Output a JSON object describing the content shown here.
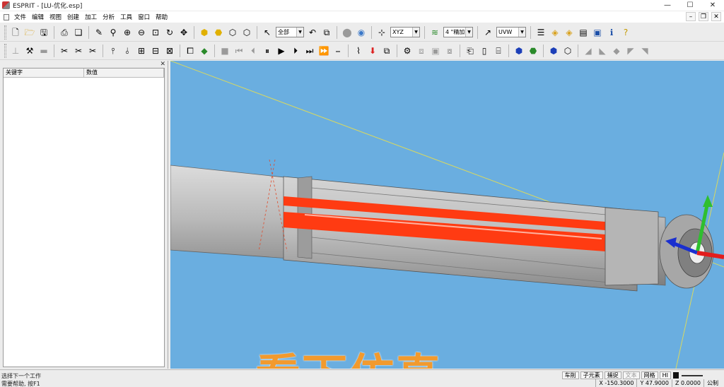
{
  "title": "ESPRIT - [LU-优化.esp]",
  "window_controls": [
    "—",
    "☐",
    "✕"
  ],
  "mdi_controls": [
    "–",
    "❐",
    "✕"
  ],
  "menu": [
    "文件",
    "编辑",
    "视图",
    "创建",
    "加工",
    "分析",
    "工具",
    "窗口",
    "帮助"
  ],
  "toolbar1": {
    "select_filter": "全部",
    "plane_combo": "XYZ",
    "layer_combo": "4 \"精加\"",
    "work_coord_combo": "UVW"
  },
  "toolbar1_icons": [
    "new-file",
    "open-folder",
    "save",
    "print",
    "print-preview",
    "sep",
    "paint-brush",
    "zoom",
    "zoom-in",
    "zoom-out",
    "zoom-window",
    "rotate",
    "pan",
    "sep",
    "solid-shade",
    "solid-shade-2",
    "wireframe",
    "hidden-lines",
    "sep",
    "select-arrow",
    "combo:select_filter",
    "undo",
    "redo-view",
    "sep",
    "stop",
    "help-circle",
    "sep",
    "axes",
    "combo:plane_combo",
    "sep",
    "layers",
    "combo:layer_combo",
    "sep",
    "work-coord",
    "combo:work_coord_combo",
    "sep",
    "list",
    "stack",
    "stack-2",
    "gallery",
    "image",
    "info",
    "help-question"
  ],
  "toolbar2_icons": [
    "tool-1",
    "tool-2",
    "tool-3",
    "sep",
    "tool-4",
    "tool-5",
    "tool-6",
    "sep",
    "feature-1",
    "feature-2",
    "feature-3",
    "feature-4",
    "feature-5",
    "sep",
    "op-1",
    "op-2",
    "sep",
    "stop-sim",
    "rewind",
    "step-back",
    "pause",
    "play",
    "step-forward",
    "fast-forward",
    "step-end",
    "step-line",
    "sep",
    "tool-path-1",
    "tool-path-2",
    "tool-path-3",
    "sep",
    "tool-a",
    "tool-b",
    "tool-c",
    "tool-d",
    "sep",
    "machine-1",
    "machine-2",
    "machine-3",
    "sep",
    "solid-1",
    "solid-2",
    "sep",
    "solid-3",
    "solid-4",
    "sep",
    "tool-e",
    "tool-f",
    "tool-g",
    "tool-h",
    "tool-i"
  ],
  "panel": {
    "columns": [
      "关键字",
      "数值"
    ]
  },
  "overlay_caption": "看下仿真",
  "status": {
    "line1": "选择下一个工作",
    "line2": "需要帮助, 按F1",
    "tabs": [
      "车削",
      "子元素",
      "捕捉",
      "文本",
      "网格",
      "HI"
    ],
    "x": "X -150.3000",
    "y": "Y 47.9000",
    "z": "Z 0.0000",
    "units": "公制"
  },
  "colors": {
    "viewport_bg": "#6aaee0",
    "toolpath": "#ff3b12",
    "overlay_text": "#f29a2e",
    "axis_y": "#2fbf2f",
    "axis_z": "#1a2fcf",
    "axis_x": "#e21d1d"
  }
}
